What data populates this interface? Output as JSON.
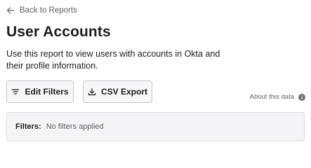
{
  "nav": {
    "back_label": "Back to Reports",
    "back_icon": "arrow-left-icon"
  },
  "header": {
    "title": "User Accounts",
    "description": "Use this report to view users with accounts in Okta and their profile information."
  },
  "toolbar": {
    "edit_filters_label": "Edit Filters",
    "edit_filters_icon": "filter-lines-icon",
    "csv_export_label": "CSV Export",
    "csv_export_icon": "download-icon",
    "about_label": "About this data",
    "about_icon": "info-icon"
  },
  "filters": {
    "label": "Filters:",
    "value": "No filters applied"
  },
  "colors": {
    "text_primary": "#1d1d21",
    "text_secondary": "#5c5e69",
    "button_bg": "#f7f7f9",
    "button_border": "#c6c8ce",
    "panel_bg": "#f4f4f6"
  }
}
